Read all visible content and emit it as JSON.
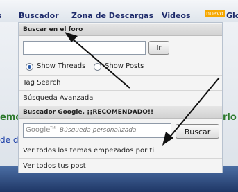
{
  "navbar": {
    "left_fragment": "s",
    "buscador": "Buscador",
    "zona_descargas": "Zona de Descargas",
    "videos": "Videos",
    "badge": "nuevo",
    "right_fragment": "Glo"
  },
  "background": {
    "green_left": "emo",
    "green_right": "rlo",
    "blue_left": "de d"
  },
  "dropdown": {
    "forum_section": {
      "header": "Buscar en el foro",
      "input_value": "",
      "go_button": "Ir",
      "radio_threads": "Show Threads",
      "radio_posts": "Show Posts",
      "selected": "Show Threads"
    },
    "tag_search": "Tag Search",
    "advanced_search": "Búsqueda Avanzada",
    "google_section": {
      "header": "Buscador Google. ¡¡RECOMENDADO!!",
      "logo": "Google",
      "logo_tm": "TM",
      "placeholder": "Búsqueda personalizada",
      "button": "Buscar"
    },
    "view_started_topics": "Ver todos los temas empezados por ti",
    "view_posts": "Ver todos tus post"
  },
  "colors": {
    "nav_text": "#1e2b6b",
    "badge": "#f6a800",
    "arrow": "#111111",
    "accent_green": "#2d7a2d"
  }
}
